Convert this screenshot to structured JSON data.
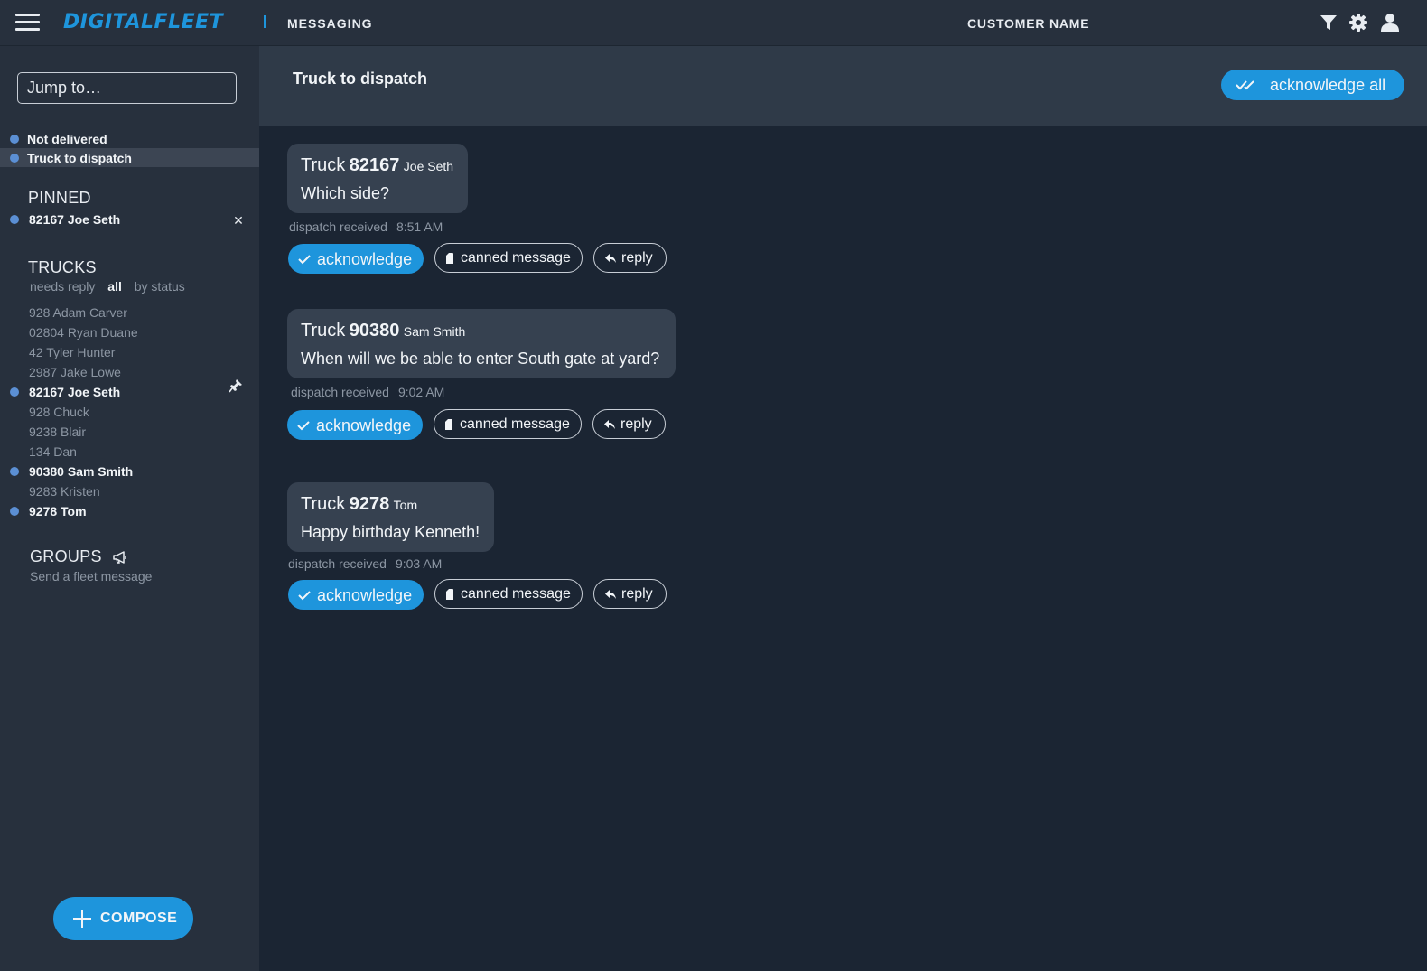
{
  "topbar": {
    "brand": "DIGITALFLEET",
    "section": "MESSAGING",
    "customer": "CUSTOMER NAME",
    "icons": [
      "menu-icon",
      "filter-icon",
      "gear-icon",
      "user-icon"
    ]
  },
  "sidebar": {
    "jump_placeholder": "Jump to…",
    "quick": [
      {
        "label": "Not delivered",
        "active": false
      },
      {
        "label": "Truck to dispatch",
        "active": true
      }
    ],
    "pinned": {
      "heading": "PINNED",
      "items": [
        {
          "label": "82167 Joe Seth",
          "unread": true
        }
      ]
    },
    "trucks": {
      "heading": "TRUCKS",
      "filters": [
        {
          "label": "needs reply",
          "active": false
        },
        {
          "label": "all",
          "active": true
        },
        {
          "label": "by status",
          "active": false
        }
      ],
      "items": [
        {
          "label": "928 Adam Carver",
          "unread": false
        },
        {
          "label": "02804 Ryan Duane",
          "unread": false
        },
        {
          "label": "42 Tyler Hunter",
          "unread": false
        },
        {
          "label": "2987 Jake Lowe",
          "unread": false
        },
        {
          "label": "82167 Joe Seth",
          "unread": true,
          "pinned": true
        },
        {
          "label": "928 Chuck",
          "unread": false
        },
        {
          "label": "9238 Blair",
          "unread": false
        },
        {
          "label": "134 Dan",
          "unread": false
        },
        {
          "label": "90380 Sam Smith",
          "unread": true
        },
        {
          "label": "9283 Kristen",
          "unread": false
        },
        {
          "label": "9278 Tom",
          "unread": true
        }
      ]
    },
    "groups": {
      "heading": "GROUPS",
      "fleet_message": "Send a fleet message"
    },
    "compose_label": "COMPOSE"
  },
  "conversation": {
    "title": "Truck to dispatch",
    "acknowledge_all": "acknowledge all",
    "messages": [
      {
        "truck_word": "Truck",
        "truck": "82167",
        "driver": "Joe Seth",
        "text": "Which side?",
        "status": "dispatch received",
        "time": "8:51 AM"
      },
      {
        "truck_word": "Truck",
        "truck": "90380",
        "driver": "Sam Smith",
        "text": "When will we be able to enter South gate at yard?",
        "status": "dispatch received",
        "time": "9:02 AM"
      },
      {
        "truck_word": "Truck",
        "truck": "9278",
        "driver": "Tom",
        "text": "Happy birthday Kenneth!",
        "status": "dispatch received",
        "time": "9:03 AM"
      }
    ],
    "actions": {
      "acknowledge": "acknowledge",
      "canned": "canned message",
      "reply": "reply"
    }
  },
  "colors": {
    "accent": "#1e95dc",
    "background": "#1b2533",
    "panel": "#27303d",
    "bubble": "#364150",
    "unread_dot": "#5b8fd4",
    "muted_text": "#8c96a3"
  }
}
